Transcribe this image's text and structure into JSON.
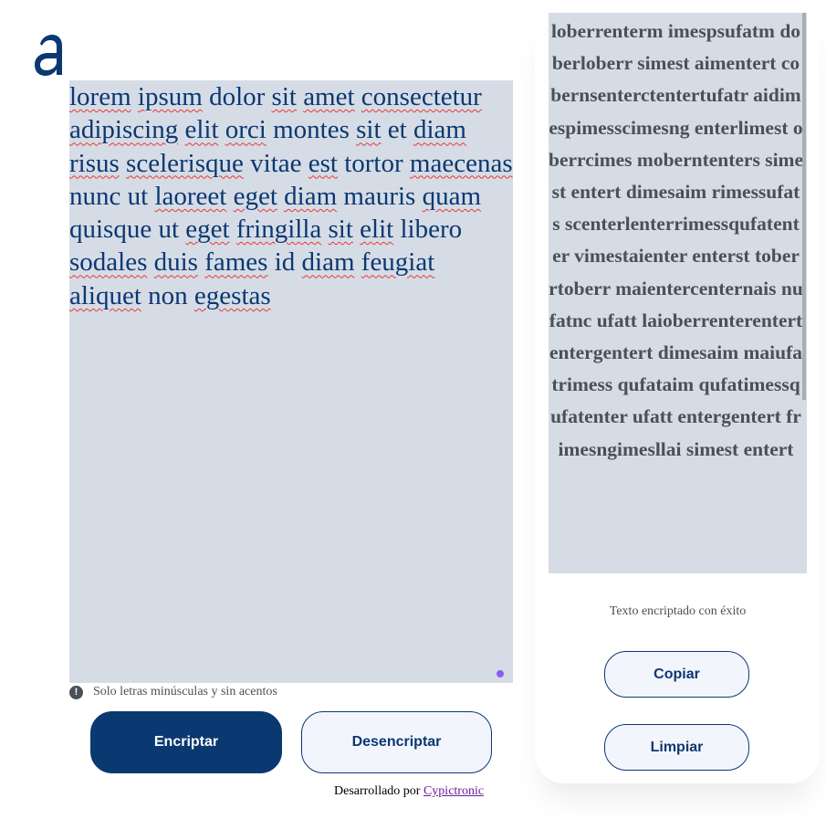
{
  "brand": {
    "logo_letter": "a",
    "color": "#0a3871"
  },
  "input": {
    "words": [
      "lorem",
      "ipsum",
      "dolor",
      "sit",
      "amet",
      "consectetur",
      "adipiscing",
      "elit",
      "orci",
      "montes",
      "sit",
      "et",
      "diam",
      "risus",
      "scelerisque",
      "vitae",
      "est",
      "tortor",
      "maecenas",
      "nunc",
      "ut",
      "laoreet",
      "eget",
      "diam",
      "mauris",
      "quam",
      "quisque",
      "ut",
      "eget",
      "fringilla",
      "sit",
      "elit",
      "libero",
      "sodales",
      "duis",
      "fames",
      "id",
      "diam",
      "feugiat",
      "aliquet",
      "non",
      "egestas"
    ],
    "misspelled": [
      "lorem",
      "ipsum",
      "sit",
      "amet",
      "consectetur",
      "adipiscing",
      "elit",
      "orci",
      "diam",
      "risus",
      "scelerisque",
      "est",
      "maecenas",
      "laoreet",
      "eget",
      "quam",
      "fringilla",
      "sodales",
      "duis",
      "fames",
      "feugiat",
      "aliquet",
      "egestas"
    ],
    "background": "#d6dce6"
  },
  "hint": {
    "icon": "exclamation-circle-icon",
    "text": "Solo letras minúsculas y sin acentos"
  },
  "buttons": {
    "encrypt": "Encriptar",
    "decrypt": "Desencriptar",
    "copy": "Copiar",
    "clear": "Limpiar"
  },
  "output": {
    "text": "loberrenterm imespsufatm doberloberr simest aimentert cobernsenterctentertufatr aidimespimesscimesng enterlimest oberrcimes moberntenters simest entert dimesaim rimessufats scenterlenterrimessqufatent er vimestaienter enterst toberrtoberr maientercenternais nufatnc ufatt laioberrenterentert entergentert dimesaim maiufatrimess qufataim qufatimessqufatenter ufatt entergentert frimesngimesllai simest entert",
    "success_message": "Texto encriptado con éxito"
  },
  "footer": {
    "prefix": "Desarrollado por ",
    "link_text": "Cypictronic"
  },
  "colors": {
    "primary": "#0a3871",
    "button_light": "#f3f5fc",
    "text_gray": "#495057",
    "spell_underline": "#e53935",
    "resize_dot": "#8b5cf6"
  }
}
